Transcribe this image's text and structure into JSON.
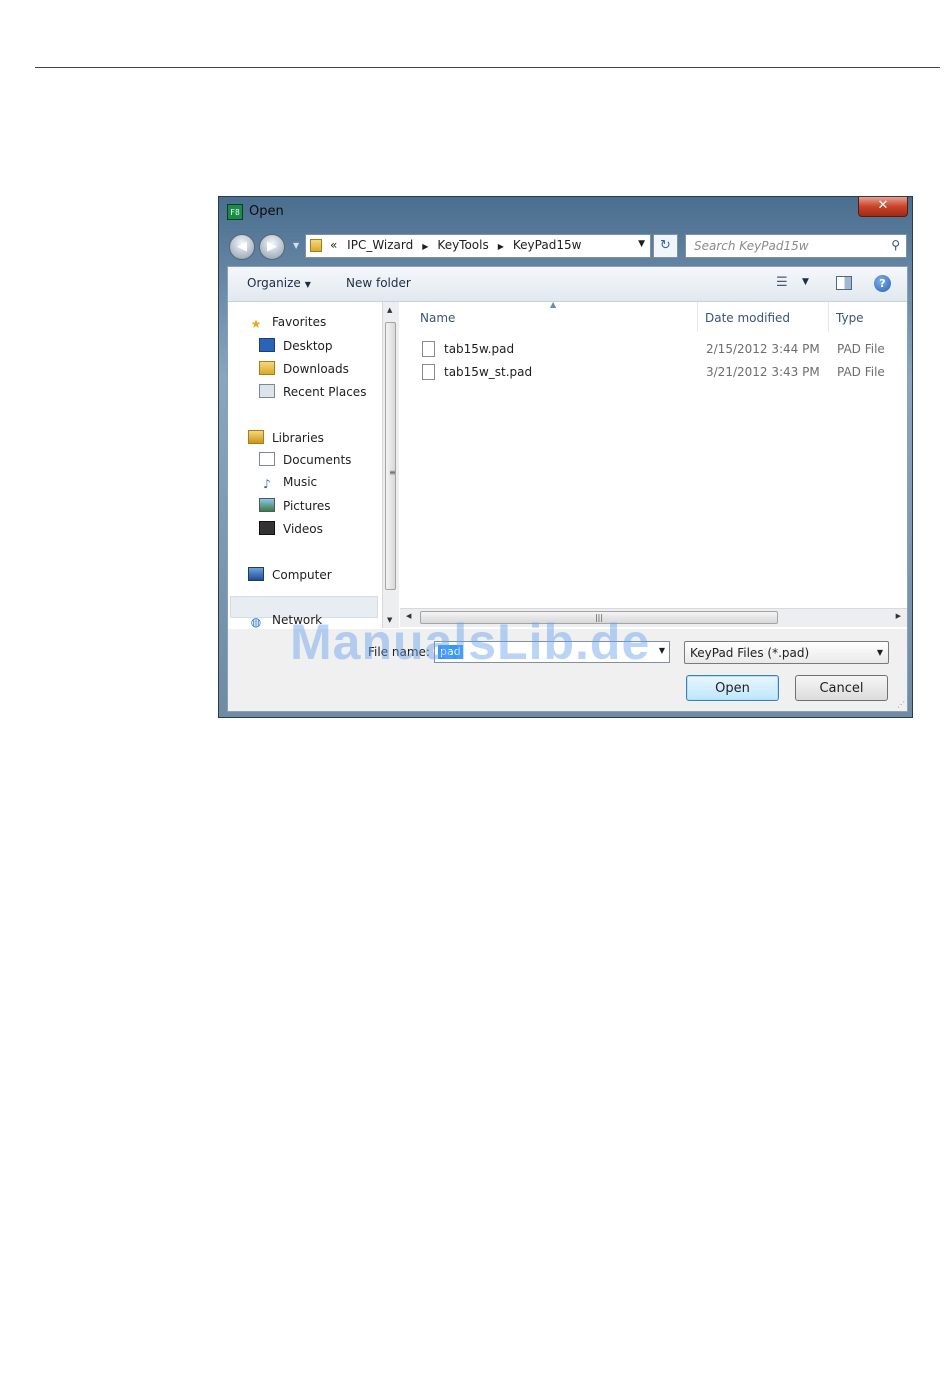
{
  "dialog": {
    "title": "Open",
    "app_icon_text": "F8",
    "close_symbol": "✕",
    "address": {
      "prefix": "«",
      "segments": [
        "IPC_Wizard",
        "KeyTools",
        "KeyPad15w"
      ]
    },
    "search_placeholder": "Search KeyPad15w",
    "toolbar": {
      "organize_label": "Organize",
      "new_folder_label": "New folder"
    },
    "nav": {
      "favorites": "Favorites",
      "desktop": "Desktop",
      "downloads": "Downloads",
      "recent_places": "Recent Places",
      "libraries": "Libraries",
      "documents": "Documents",
      "music": "Music",
      "pictures": "Pictures",
      "videos": "Videos",
      "computer": "Computer",
      "network": "Network"
    },
    "columns": {
      "name": "Name",
      "date_modified": "Date modified",
      "type": "Type"
    },
    "files": [
      {
        "name": "tab15w.pad",
        "date": "2/15/2012 3:44 PM",
        "type": "PAD File"
      },
      {
        "name": "tab15w_st.pad",
        "date": "3/21/2012 3:43 PM",
        "type": "PAD File"
      }
    ],
    "filename_label": "File name:",
    "filename_value": "pad",
    "filetype_value": "KeyPad Files (*.pad)",
    "open_label": "Open",
    "cancel_label": "Cancel"
  },
  "watermark": "ManualsLib.de",
  "colors": {
    "selection": "#3399ff",
    "link_blue": "#3a5472",
    "watermark": "#64a0eb"
  }
}
